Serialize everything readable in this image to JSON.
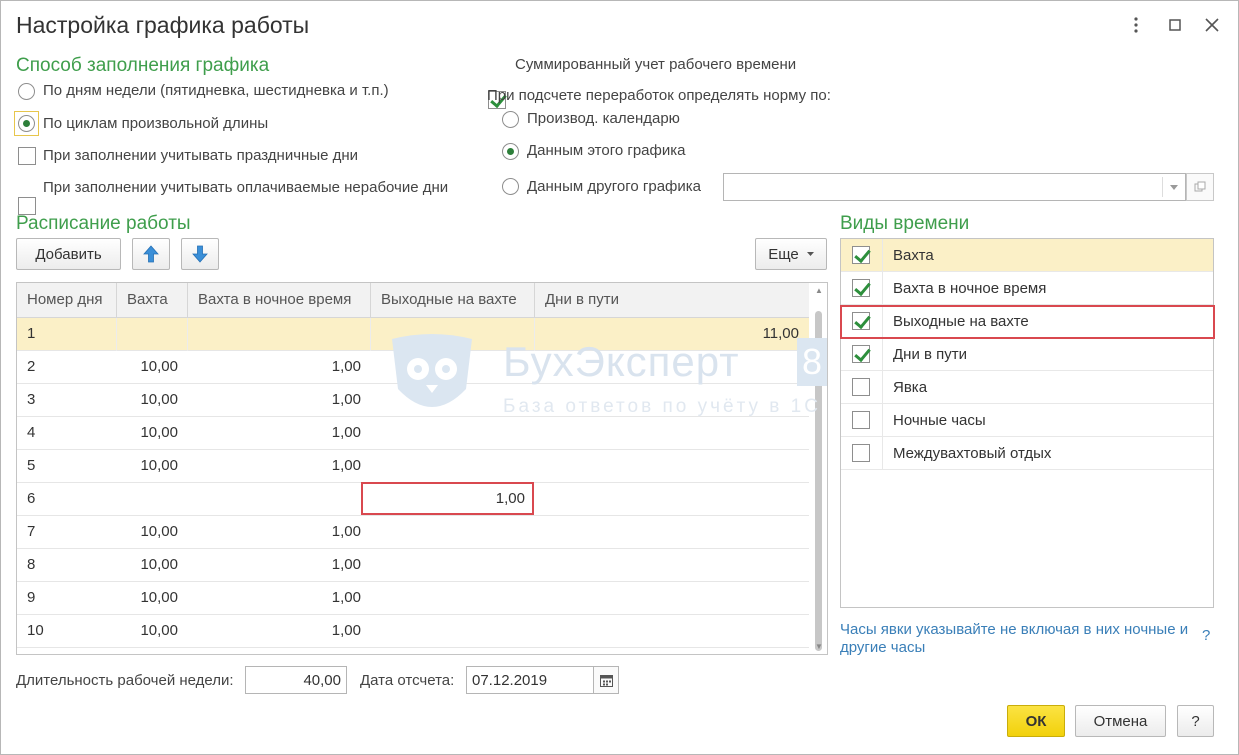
{
  "window": {
    "title": "Настройка графика работы"
  },
  "fill_method": {
    "heading": "Способ заполнения графика",
    "option_weekdays": "По дням недели (пятидневка, шестидневка и т.п.)",
    "option_cycles": "По циклам произвольной длины",
    "selected": "cycles",
    "holidays_label": "При заполнении учитывать праздничные дни",
    "holidays_checked": false,
    "nonworking_label": "При заполнении учитывать оплачиваемые нерабочие дни",
    "nonworking_checked": false
  },
  "summary": {
    "summed_label": "Суммированный учет рабочего времени",
    "summed_checked": true,
    "norm_label": "При подсчете переработок определять норму по:",
    "opt_calendar": "Производ. календарю",
    "opt_this": "Данным этого графика",
    "opt_other": "Данным другого графика",
    "selected": "this",
    "other_schedule_value": ""
  },
  "schedule": {
    "heading": "Расписание работы",
    "add_label": "Добавить",
    "more_label": "Еще",
    "columns": [
      "Номер дня",
      "Вахта",
      "Вахта в ночное время",
      "Выходные на вахте",
      "Дни в пути"
    ],
    "rows": [
      {
        "day": "1",
        "vahta": "",
        "night": "",
        "off": "",
        "travel": "11,00"
      },
      {
        "day": "2",
        "vahta": "10,00",
        "night": "1,00",
        "off": "",
        "travel": ""
      },
      {
        "day": "3",
        "vahta": "10,00",
        "night": "1,00",
        "off": "",
        "travel": ""
      },
      {
        "day": "4",
        "vahta": "10,00",
        "night": "1,00",
        "off": "",
        "travel": ""
      },
      {
        "day": "5",
        "vahta": "10,00",
        "night": "1,00",
        "off": "",
        "travel": ""
      },
      {
        "day": "6",
        "vahta": "",
        "night": "",
        "off": "1,00",
        "travel": ""
      },
      {
        "day": "7",
        "vahta": "10,00",
        "night": "1,00",
        "off": "",
        "travel": ""
      },
      {
        "day": "8",
        "vahta": "10,00",
        "night": "1,00",
        "off": "",
        "travel": ""
      },
      {
        "day": "9",
        "vahta": "10,00",
        "night": "1,00",
        "off": "",
        "travel": ""
      },
      {
        "day": "10",
        "vahta": "10,00",
        "night": "1,00",
        "off": "",
        "travel": ""
      }
    ]
  },
  "time_types": {
    "heading": "Виды времени",
    "items": [
      {
        "label": "Вахта",
        "checked": true
      },
      {
        "label": "Вахта в ночное время",
        "checked": true
      },
      {
        "label": "Выходные на вахте",
        "checked": true
      },
      {
        "label": "Дни в пути",
        "checked": true
      },
      {
        "label": "Явка",
        "checked": false
      },
      {
        "label": "Ночные часы",
        "checked": false
      },
      {
        "label": "Междувахтовый отдых",
        "checked": false
      }
    ],
    "hint": "Часы явки указывайте не включая в них ночные и другие часы",
    "help": "?"
  },
  "footer": {
    "week_label": "Длительность рабочей недели:",
    "week_value": "40,00",
    "date_label": "Дата отсчета:",
    "date_value": "07.12.2019",
    "ok_label": "ОК",
    "cancel_label": "Отмена",
    "help_label": "?"
  },
  "watermark": {
    "name": "БухЭксперт",
    "digit": "8",
    "tagline": "База ответов по учёту в 1С"
  },
  "colors": {
    "section_title": "#3f9e4c",
    "selection": "#fbf0c7",
    "highlight_border": "#d9484f",
    "ok_button": "#f5d81e",
    "hint_link": "#3a7fb8"
  }
}
